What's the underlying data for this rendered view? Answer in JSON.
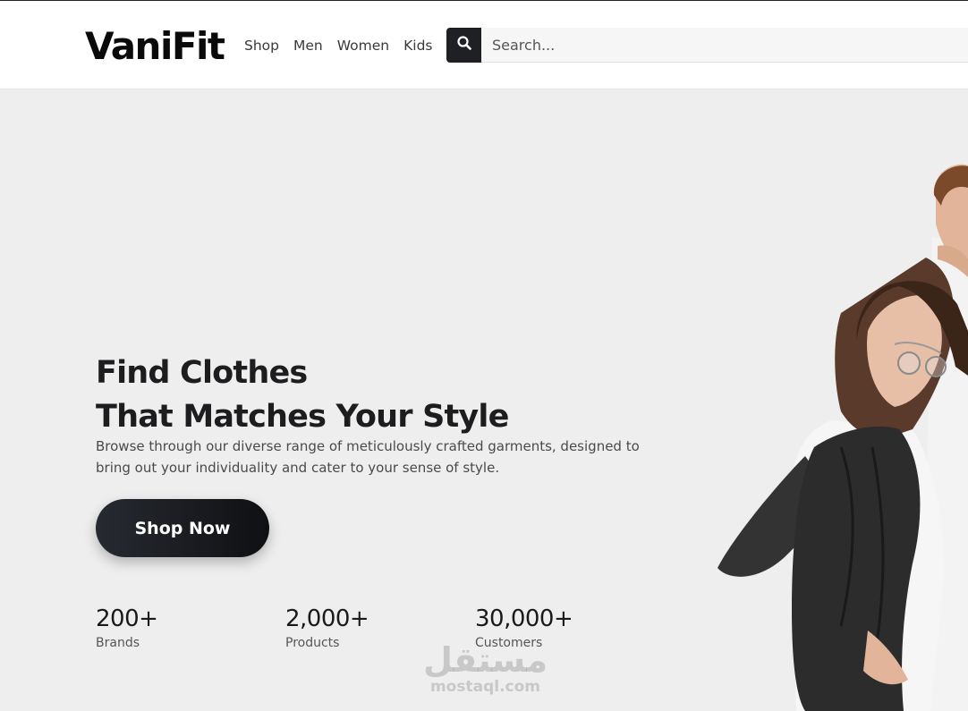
{
  "header": {
    "logo": "VaniFit",
    "nav": [
      {
        "label": "Shop"
      },
      {
        "label": "Men"
      },
      {
        "label": "Women"
      },
      {
        "label": "Kids"
      }
    ],
    "search": {
      "placeholder": "Search..."
    }
  },
  "hero": {
    "title_line1": "Find Clothes",
    "title_line2": "That Matches Your Style",
    "description": "Browse through our diverse range of meticulously crafted garments, designed to bring out your individuality and cater to your sense of style.",
    "cta_label": "Shop Now",
    "stats": [
      {
        "value": "200+",
        "label": "Brands"
      },
      {
        "value": "2,000+",
        "label": "Products"
      },
      {
        "value": "30,000+",
        "label": "Customers"
      }
    ]
  },
  "watermark": {
    "arabic": "مستقل",
    "latin": "mostaql.com"
  },
  "colors": {
    "dark": "#1e2024",
    "background": "#efeeee"
  },
  "icons": {
    "search": "search-icon"
  }
}
